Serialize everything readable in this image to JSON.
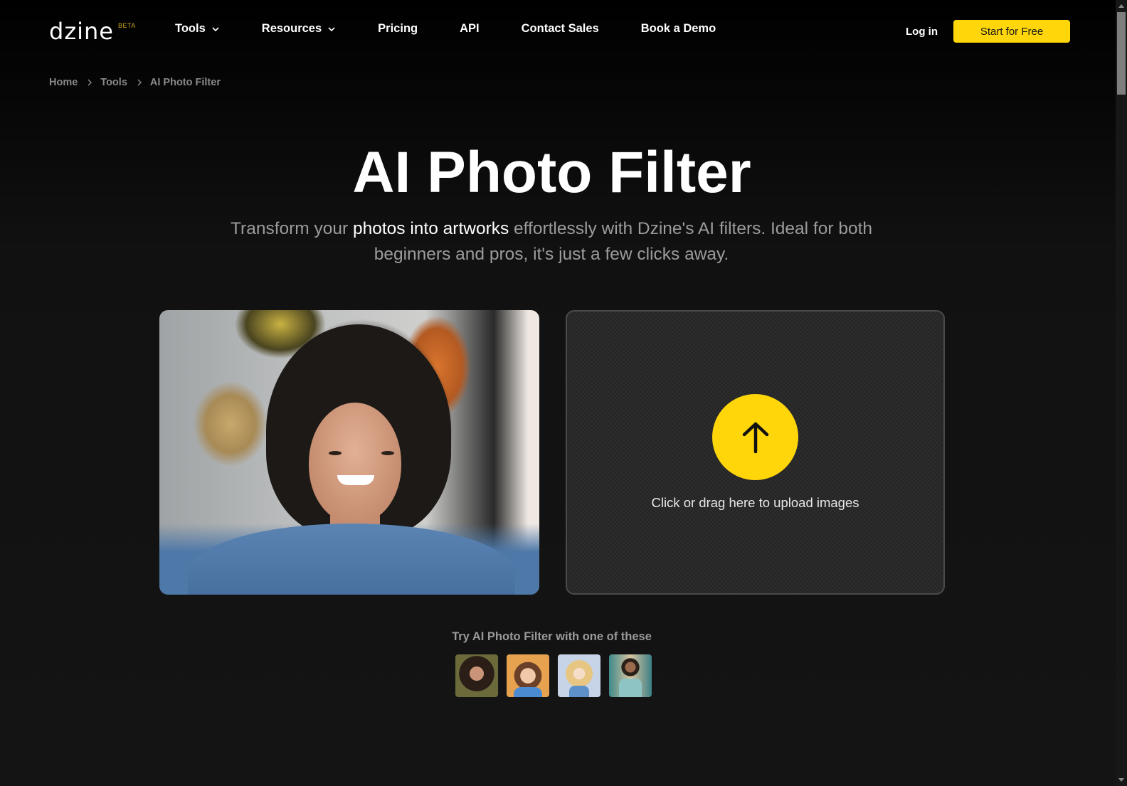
{
  "nav": {
    "logo": "dzine",
    "logo_badge": "BETA",
    "links": [
      {
        "label": "Tools",
        "has_dropdown": true
      },
      {
        "label": "Resources",
        "has_dropdown": true
      },
      {
        "label": "Pricing",
        "has_dropdown": false
      },
      {
        "label": "API",
        "has_dropdown": false
      },
      {
        "label": "Contact Sales",
        "has_dropdown": false
      },
      {
        "label": "Book a Demo",
        "has_dropdown": false
      }
    ],
    "login_label": "Log in",
    "cta_label": "Start for Free"
  },
  "breadcrumb": [
    {
      "label": "Home"
    },
    {
      "label": "Tools"
    },
    {
      "label": "AI Photo Filter"
    }
  ],
  "hero": {
    "title": "AI Photo Filter",
    "subtitle_pre": "Transform your ",
    "subtitle_highlight": "photos into artworks",
    "subtitle_post": " effortlessly with Dzine's AI filters. Ideal for both beginners and pros, it's just a few clicks away."
  },
  "preview": {
    "icon": "portrait-photo"
  },
  "upload": {
    "icon": "arrow-up-icon",
    "label": "Click or drag here to upload images"
  },
  "samples": {
    "label": "Try AI Photo Filter with one of these",
    "items": [
      {
        "name": "curly-hair-woman-photo"
      },
      {
        "name": "cartoon-boy"
      },
      {
        "name": "fairy-illustration"
      },
      {
        "name": "man-street-photo"
      }
    ]
  },
  "colors": {
    "accent": "#ffd60a",
    "background": "#111111",
    "muted_text": "#9c9c9c"
  }
}
